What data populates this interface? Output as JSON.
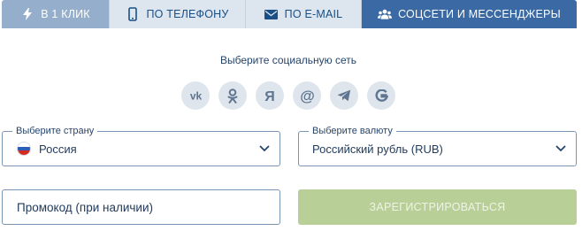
{
  "tabs": [
    {
      "label": "В 1 КЛИК",
      "icon": "lightning-icon",
      "active": false
    },
    {
      "label": "ПО ТЕЛЕФОНУ",
      "icon": "phone-icon",
      "active": false
    },
    {
      "label": "ПО E-MAIL",
      "icon": "envelope-icon",
      "active": false
    },
    {
      "label": "СОЦСЕТИ И МЕССЕНДЖЕРЫ",
      "icon": "users-icon",
      "active": true
    }
  ],
  "social": {
    "title": "Выберите социальную сеть",
    "networks": [
      {
        "name": "vk",
        "icon": "vk-icon"
      },
      {
        "name": "odnoklassniki",
        "icon": "odnoklassniki-icon"
      },
      {
        "name": "yandex",
        "icon": "yandex-icon"
      },
      {
        "name": "mail-ru",
        "icon": "at-icon"
      },
      {
        "name": "telegram",
        "icon": "telegram-icon"
      },
      {
        "name": "google",
        "icon": "google-icon"
      }
    ]
  },
  "country": {
    "legend": "Выберите страну",
    "value": "Россия",
    "flag_icon": "russia-flag-icon"
  },
  "currency": {
    "legend": "Выберите валюту",
    "value": "Российский рубль (RUB)"
  },
  "promo": {
    "placeholder": "Промокод (при наличии)",
    "value": ""
  },
  "submit": {
    "label": "ЗАРЕГИСТРИРОВАТЬСЯ"
  },
  "colors": {
    "tab_active": "#3a69a3",
    "tab_first": "#95aecb",
    "tab_inactive": "#dde6ef",
    "accent_text": "#1a4f86",
    "field_border": "#7b95b5",
    "social_bg": "#dfe5ec",
    "submit_disabled": "#b9cf98"
  }
}
